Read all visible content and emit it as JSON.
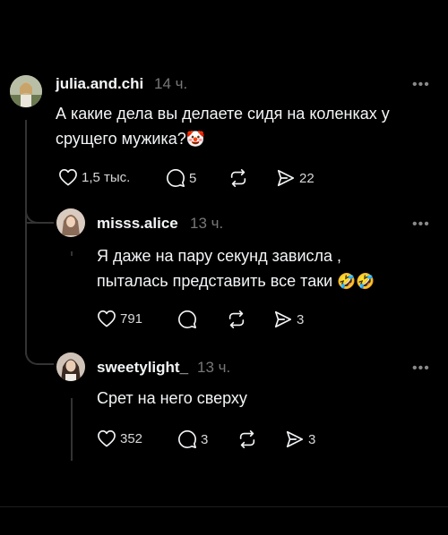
{
  "post": {
    "username": "julia.and.chi",
    "time": "14 ч.",
    "text": "А какие дела вы делаете сидя на коленках у срущего мужика?",
    "emoji": "🤡",
    "likes": "1,5 тыс.",
    "comments": "5",
    "shares": "22"
  },
  "replies": [
    {
      "username": "misss.alice",
      "time": "13 ч.",
      "line1": "Я даже на пару секунд зависла ,",
      "line2": "пыталась представить все таки",
      "emoji": "🤣🤣",
      "likes": "791",
      "comments": "",
      "shares": "3"
    },
    {
      "username": "sweetylight_",
      "time": "13 ч.",
      "text": "Срет на него сверху",
      "likes": "352",
      "comments": "3",
      "shares": "3"
    }
  ],
  "colors": {
    "background": "#000000",
    "text": "#f3f5f7",
    "muted": "#777777",
    "thread_line": "#333333"
  },
  "icons": [
    "heart-icon",
    "comment-icon",
    "repost-icon",
    "send-icon",
    "more-icon"
  ]
}
